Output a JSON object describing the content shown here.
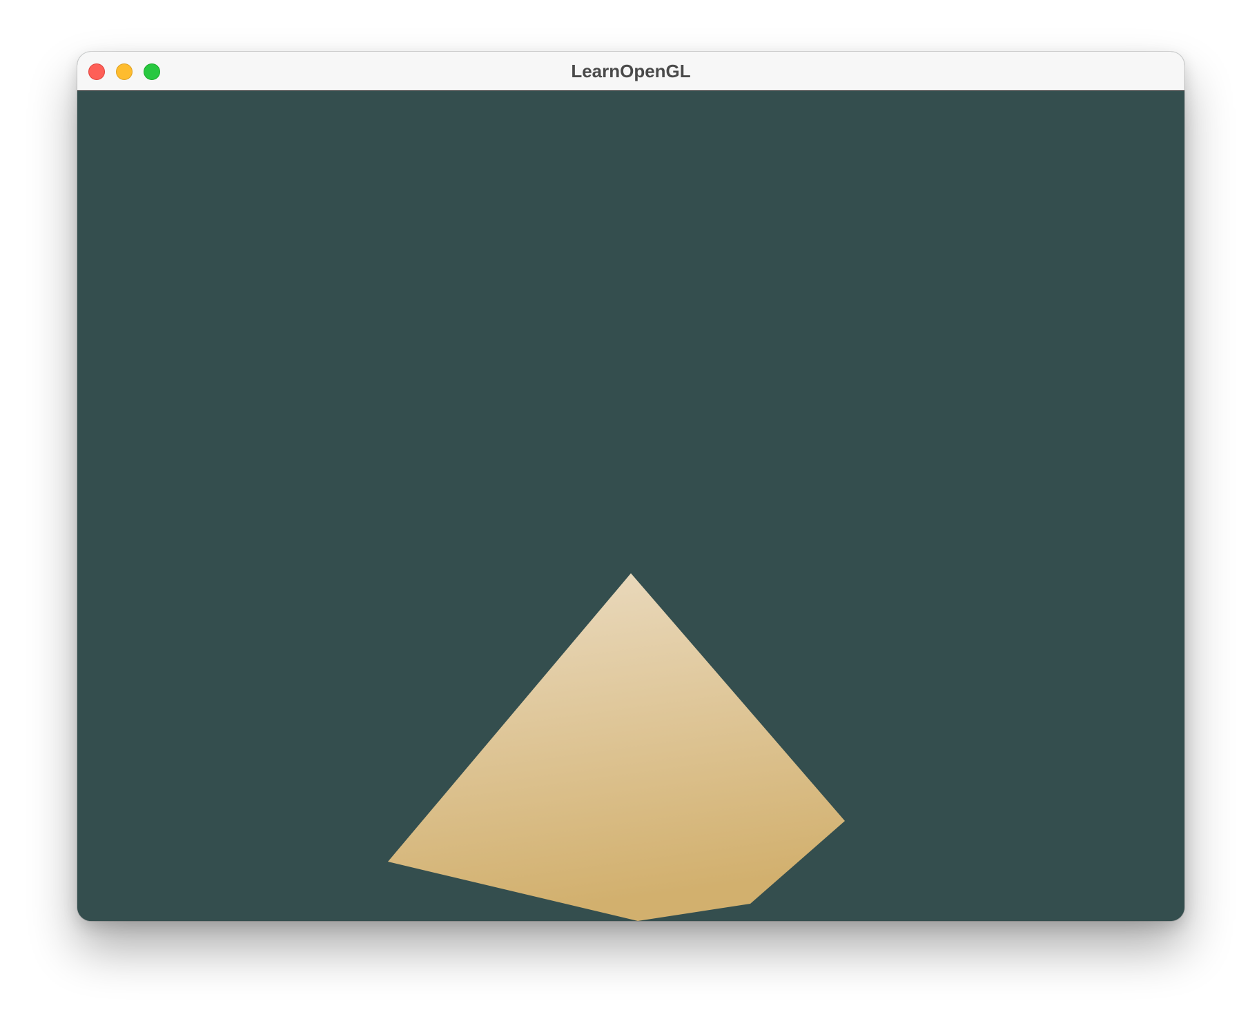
{
  "window": {
    "title": "LearnOpenGL"
  },
  "traffic_lights": [
    {
      "name": "close-button",
      "color": "#fe5f57"
    },
    {
      "name": "minimize-button",
      "color": "#febc2e"
    },
    {
      "name": "zoom-button",
      "color": "#28c840"
    }
  ],
  "viewport": {
    "clear_color": "#344e4e",
    "shape": {
      "fill_top_color": "#ebdcc2",
      "fill_bottom_color": "#d2b06e"
    }
  }
}
